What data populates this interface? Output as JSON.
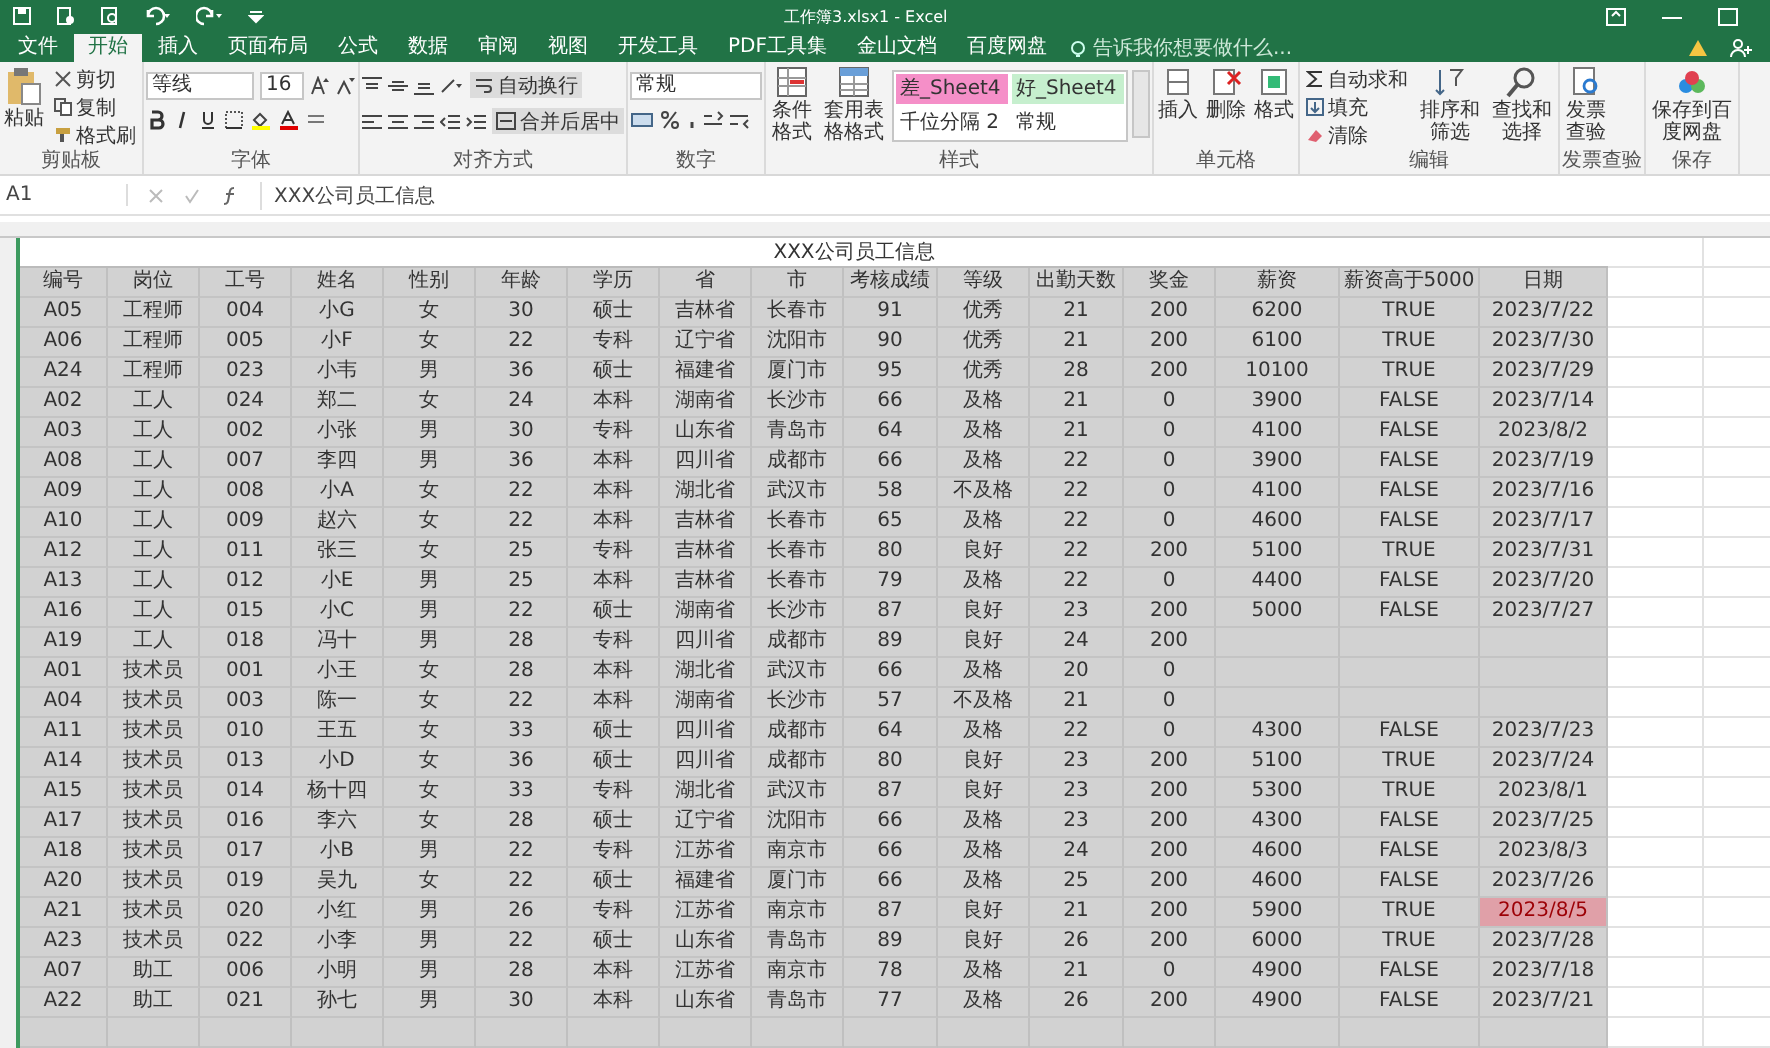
{
  "window": {
    "title": "工作簿3.xlsx1 - Excel"
  },
  "tabs": [
    {
      "label": "文件",
      "selected": false
    },
    {
      "label": "开始",
      "selected": true
    },
    {
      "label": "插入",
      "selected": false
    },
    {
      "label": "页面布局",
      "selected": false
    },
    {
      "label": "公式",
      "selected": false
    },
    {
      "label": "数据",
      "selected": false
    },
    {
      "label": "审阅",
      "selected": false
    },
    {
      "label": "视图",
      "selected": false
    },
    {
      "label": "开发工具",
      "selected": false
    },
    {
      "label": "PDF工具集",
      "selected": false
    },
    {
      "label": "金山文档",
      "selected": false
    },
    {
      "label": "百度网盘",
      "selected": false
    }
  ],
  "tell_me": {
    "placeholder": "告诉我你想要做什么..."
  },
  "ribbon": {
    "clipboard": {
      "paste": "粘贴",
      "cut": "剪切",
      "copy": "复制",
      "painter": "格式刷",
      "label": "剪贴板"
    },
    "font": {
      "name": "等线",
      "size": "16",
      "label": "字体"
    },
    "alignment": {
      "wrap": "自动换行",
      "merge": "合并后居中",
      "label": "对齐方式"
    },
    "number": {
      "format": "常规",
      "label": "数字"
    },
    "styles": {
      "conditional": "条件格式",
      "table": "套用表格格式",
      "cells": [
        {
          "label": "差_Sheet4",
          "color": "#f58fc8"
        },
        {
          "label": "好_Sheet4",
          "color": "#c6efce"
        },
        {
          "label": "千位分隔 2",
          "color": "#ffffff"
        },
        {
          "label": "常规",
          "color": "#ffffff"
        }
      ],
      "label": "样式"
    },
    "cells": {
      "insert": "插入",
      "delete": "删除",
      "format": "格式",
      "label": "单元格"
    },
    "editing": {
      "autosum": "自动求和",
      "fill": "填充",
      "clear": "清除",
      "sort": "排序和筛选",
      "find": "查找和选择",
      "label": "编辑"
    },
    "invoice": {
      "button": "发票查验",
      "label": "发票查验"
    },
    "save": {
      "button": "保存到百度网盘",
      "label": "保存"
    }
  },
  "formula_bar": {
    "name_box": "A1",
    "formula": "XXX公司员工信息"
  },
  "sheet": {
    "title": "XXX公司员工信息",
    "columns": [
      "编号",
      "岗位",
      "工号",
      "姓名",
      "性别",
      "年龄",
      "学历",
      "省",
      "市",
      "考核成绩",
      "等级",
      "出勤天数",
      "奖金",
      "薪资",
      "薪资高于5000",
      "日期"
    ],
    "rows": [
      {
        "cells": [
          "A05",
          "工程师",
          "004",
          "小G",
          "女",
          "30",
          "硕士",
          "吉林省",
          "长春市",
          "91",
          "优秀",
          "21",
          "200",
          "6200",
          "TRUE",
          "2023/7/22"
        ],
        "date_highlighted": false
      },
      {
        "cells": [
          "A06",
          "工程师",
          "005",
          "小F",
          "女",
          "22",
          "专科",
          "辽宁省",
          "沈阳市",
          "90",
          "优秀",
          "21",
          "200",
          "6100",
          "TRUE",
          "2023/7/30"
        ],
        "date_highlighted": false
      },
      {
        "cells": [
          "A24",
          "工程师",
          "023",
          "小韦",
          "男",
          "36",
          "硕士",
          "福建省",
          "厦门市",
          "95",
          "优秀",
          "28",
          "200",
          "10100",
          "TRUE",
          "2023/7/29"
        ],
        "date_highlighted": false
      },
      {
        "cells": [
          "A02",
          "工人",
          "024",
          "郑二",
          "女",
          "24",
          "本科",
          "湖南省",
          "长沙市",
          "66",
          "及格",
          "21",
          "0",
          "3900",
          "FALSE",
          "2023/7/14"
        ],
        "date_highlighted": false
      },
      {
        "cells": [
          "A03",
          "工人",
          "002",
          "小张",
          "男",
          "30",
          "专科",
          "山东省",
          "青岛市",
          "64",
          "及格",
          "21",
          "0",
          "4100",
          "FALSE",
          "2023/8/2"
        ],
        "date_highlighted": false
      },
      {
        "cells": [
          "A08",
          "工人",
          "007",
          "李四",
          "男",
          "36",
          "本科",
          "四川省",
          "成都市",
          "66",
          "及格",
          "22",
          "0",
          "3900",
          "FALSE",
          "2023/7/19"
        ],
        "date_highlighted": false
      },
      {
        "cells": [
          "A09",
          "工人",
          "008",
          "小A",
          "女",
          "22",
          "本科",
          "湖北省",
          "武汉市",
          "58",
          "不及格",
          "22",
          "0",
          "4100",
          "FALSE",
          "2023/7/16"
        ],
        "date_highlighted": false
      },
      {
        "cells": [
          "A10",
          "工人",
          "009",
          "赵六",
          "女",
          "22",
          "本科",
          "吉林省",
          "长春市",
          "65",
          "及格",
          "22",
          "0",
          "4600",
          "FALSE",
          "2023/7/17"
        ],
        "date_highlighted": false
      },
      {
        "cells": [
          "A12",
          "工人",
          "011",
          "张三",
          "女",
          "25",
          "专科",
          "吉林省",
          "长春市",
          "80",
          "良好",
          "22",
          "200",
          "5100",
          "TRUE",
          "2023/7/31"
        ],
        "date_highlighted": false
      },
      {
        "cells": [
          "A13",
          "工人",
          "012",
          "小E",
          "男",
          "25",
          "本科",
          "吉林省",
          "长春市",
          "79",
          "及格",
          "22",
          "0",
          "4400",
          "FALSE",
          "2023/7/20"
        ],
        "date_highlighted": false
      },
      {
        "cells": [
          "A16",
          "工人",
          "015",
          "小C",
          "男",
          "22",
          "硕士",
          "湖南省",
          "长沙市",
          "87",
          "良好",
          "23",
          "200",
          "5000",
          "FALSE",
          "2023/7/27"
        ],
        "date_highlighted": false
      },
      {
        "cells": [
          "A19",
          "工人",
          "018",
          "冯十",
          "男",
          "28",
          "专科",
          "四川省",
          "成都市",
          "89",
          "良好",
          "24",
          "200"
        ]
      },
      {
        "cells": [
          "A01",
          "技术员",
          "001",
          "小王",
          "女",
          "28",
          "本科",
          "湖北省",
          "武汉市",
          "66",
          "及格",
          "20",
          "0"
        ]
      },
      {
        "cells": [
          "A04",
          "技术员",
          "003",
          "陈一",
          "女",
          "22",
          "本科",
          "湖南省",
          "长沙市",
          "57",
          "不及格",
          "21",
          "0"
        ]
      },
      {
        "cells": [
          "A11",
          "技术员",
          "010",
          "王五",
          "女",
          "33",
          "硕士",
          "四川省",
          "成都市",
          "64",
          "及格",
          "22",
          "0",
          "4300",
          "FALSE",
          "2023/7/23"
        ],
        "date_highlighted": false
      },
      {
        "cells": [
          "A14",
          "技术员",
          "013",
          "小D",
          "女",
          "36",
          "硕士",
          "四川省",
          "成都市",
          "80",
          "良好",
          "23",
          "200",
          "5100",
          "TRUE",
          "2023/7/24"
        ],
        "date_highlighted": false
      },
      {
        "cells": [
          "A15",
          "技术员",
          "014",
          "杨十四",
          "女",
          "33",
          "专科",
          "湖北省",
          "武汉市",
          "87",
          "良好",
          "23",
          "200",
          "5300",
          "TRUE",
          "2023/8/1"
        ],
        "date_highlighted": false
      },
      {
        "cells": [
          "A17",
          "技术员",
          "016",
          "李六",
          "女",
          "28",
          "硕士",
          "辽宁省",
          "沈阳市",
          "66",
          "及格",
          "23",
          "200",
          "4300",
          "FALSE",
          "2023/7/25"
        ],
        "date_highlighted": false
      },
      {
        "cells": [
          "A18",
          "技术员",
          "017",
          "小B",
          "男",
          "22",
          "专科",
          "江苏省",
          "南京市",
          "66",
          "及格",
          "24",
          "200",
          "4600",
          "FALSE",
          "2023/8/3"
        ],
        "date_highlighted": false
      },
      {
        "cells": [
          "A20",
          "技术员",
          "019",
          "吴九",
          "女",
          "22",
          "硕士",
          "福建省",
          "厦门市",
          "66",
          "及格",
          "25",
          "200",
          "4600",
          "FALSE",
          "2023/7/26"
        ],
        "date_highlighted": false
      },
      {
        "cells": [
          "A21",
          "技术员",
          "020",
          "小红",
          "男",
          "26",
          "专科",
          "江苏省",
          "南京市",
          "87",
          "良好",
          "21",
          "200",
          "5900",
          "TRUE",
          "2023/8/5"
        ],
        "date_highlighted": true
      },
      {
        "cells": [
          "A23",
          "技术员",
          "022",
          "小李",
          "男",
          "22",
          "硕士",
          "山东省",
          "青岛市",
          "89",
          "良好",
          "26",
          "200",
          "6000",
          "TRUE",
          "2023/7/28"
        ],
        "date_highlighted": false
      },
      {
        "cells": [
          "A07",
          "助工",
          "006",
          "小明",
          "男",
          "28",
          "本科",
          "江苏省",
          "南京市",
          "78",
          "及格",
          "21",
          "0",
          "4900",
          "FALSE",
          "2023/7/18"
        ],
        "date_highlighted": false
      },
      {
        "cells": [
          "A22",
          "助工",
          "021",
          "孙七",
          "男",
          "30",
          "本科",
          "山东省",
          "青岛市",
          "77",
          "及格",
          "26",
          "200",
          "4900",
          "FALSE",
          "2023/7/21"
        ],
        "date_highlighted": false
      }
    ]
  }
}
